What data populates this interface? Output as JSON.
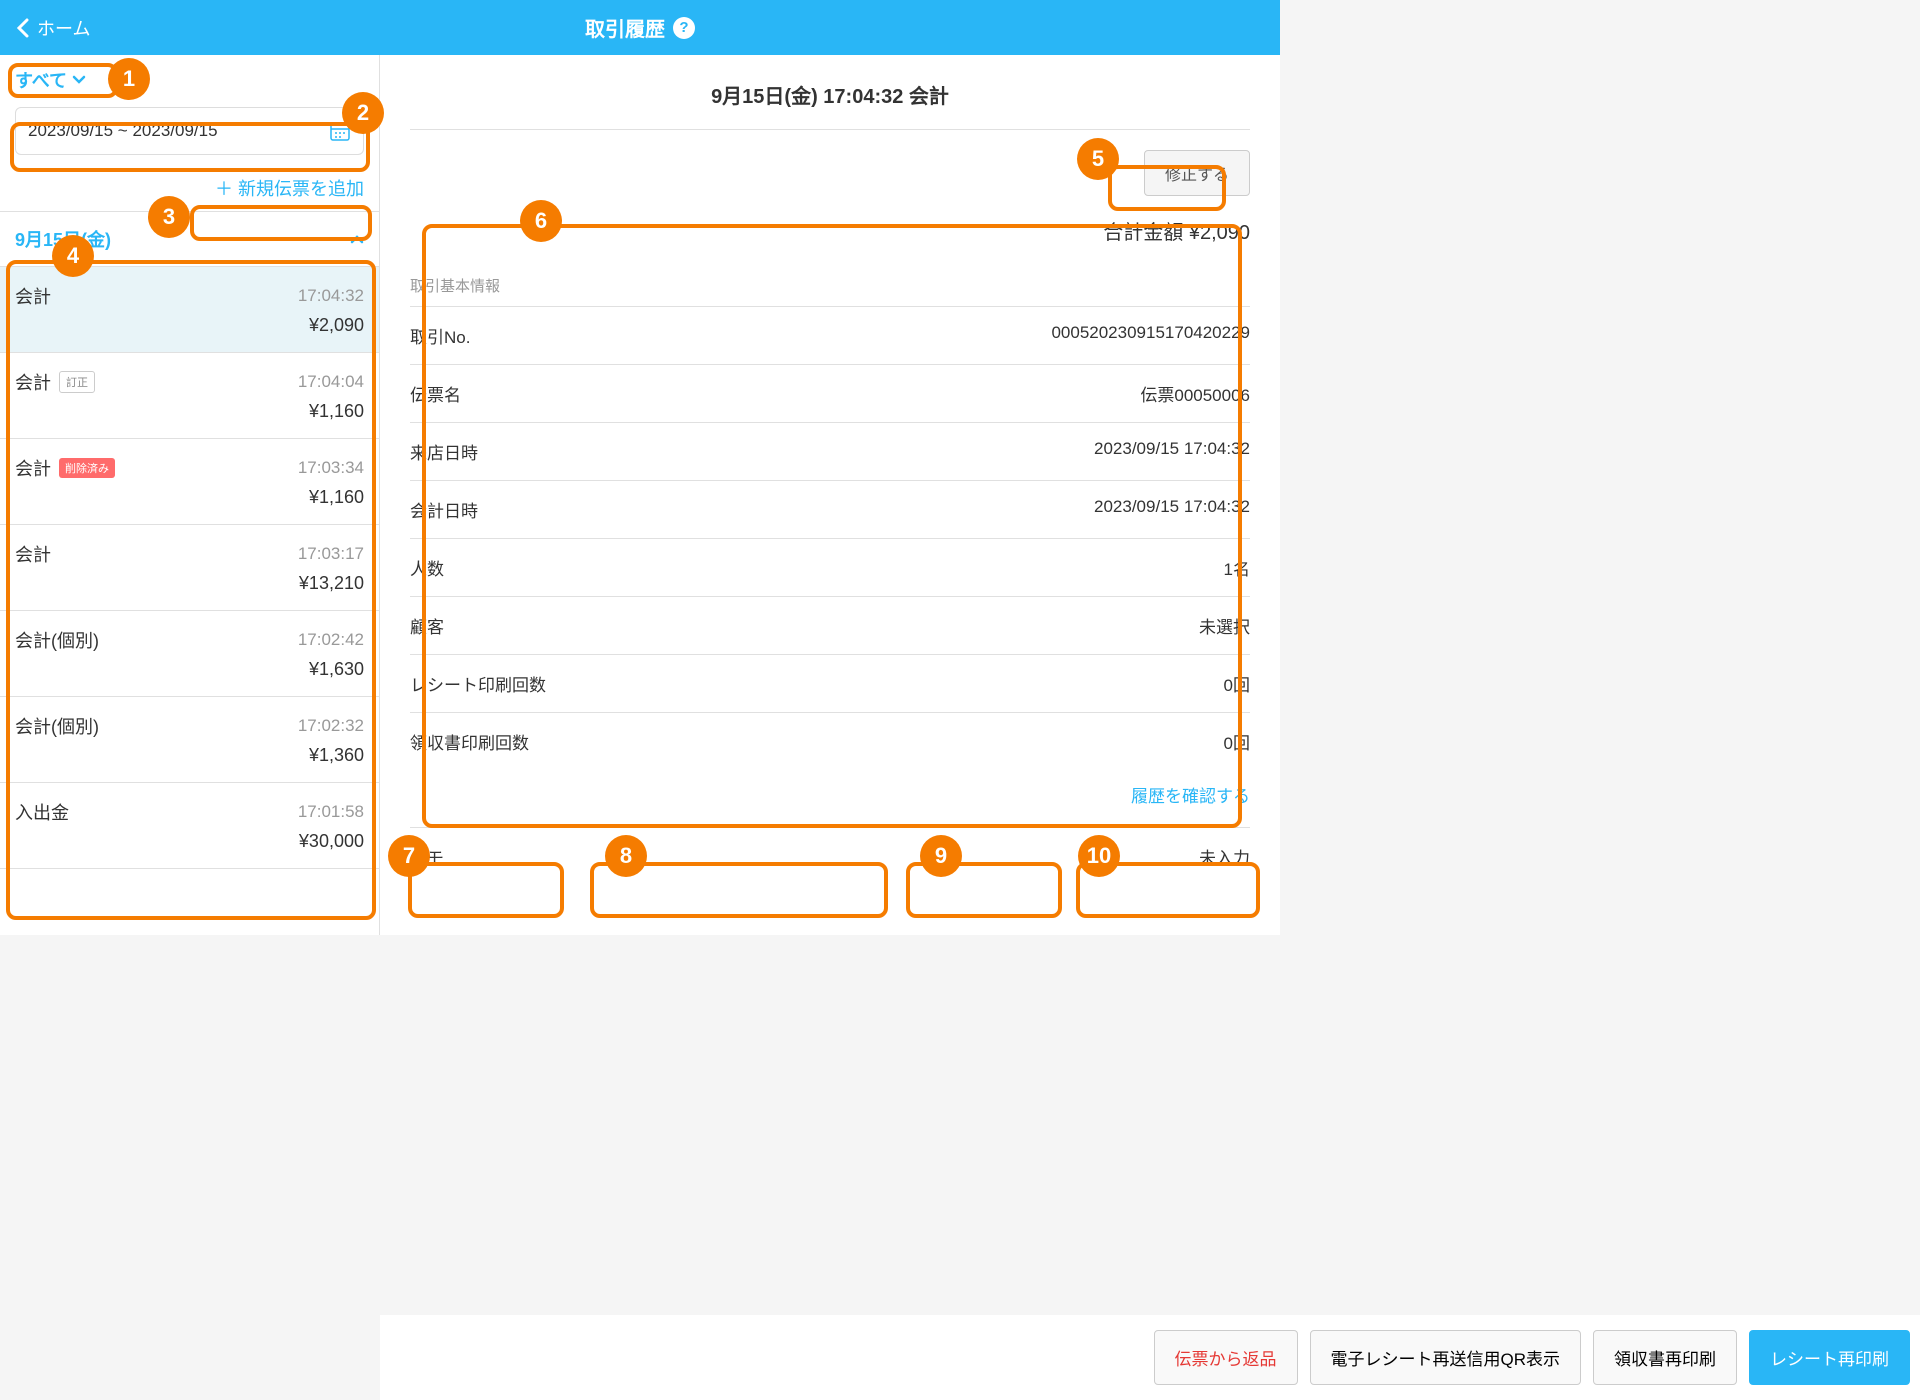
{
  "header": {
    "back_label": "ホーム",
    "title": "取引履歴"
  },
  "sidebar": {
    "filter_label": "すべて",
    "date_range": "2023/09/15 ~ 2023/09/15",
    "add_slip_label": "＋ 新規伝票を追加",
    "date_header": "9月15日(金)",
    "transactions": [
      {
        "label": "会計",
        "time": "17:04:32",
        "amount": "¥2,090",
        "badge": null,
        "selected": true
      },
      {
        "label": "会計",
        "time": "17:04:04",
        "amount": "¥1,160",
        "badge": "訂正",
        "selected": false
      },
      {
        "label": "会計",
        "time": "17:03:34",
        "amount": "¥1,160",
        "badge": "削除済み",
        "badge_type": "deleted",
        "selected": false
      },
      {
        "label": "会計",
        "time": "17:03:17",
        "amount": "¥13,210",
        "badge": null,
        "selected": false
      },
      {
        "label": "会計(個別)",
        "time": "17:02:42",
        "amount": "¥1,630",
        "badge": null,
        "selected": false
      },
      {
        "label": "会計(個別)",
        "time": "17:02:32",
        "amount": "¥1,360",
        "badge": null,
        "selected": false
      },
      {
        "label": "入出金",
        "time": "17:01:58",
        "amount": "¥30,000",
        "badge": null,
        "selected": false
      }
    ]
  },
  "main": {
    "title": "9月15日(金) 17:04:32 会計",
    "edit_button": "修正する",
    "total_label": "合計金額 ¥2,090",
    "section_label": "取引基本情報",
    "info": [
      {
        "label": "取引No.",
        "value": "000520230915170420229"
      },
      {
        "label": "伝票名",
        "value": "伝票00050006"
      },
      {
        "label": "来店日時",
        "value": "2023/09/15 17:04:32"
      },
      {
        "label": "会計日時",
        "value": "2023/09/15 17:04:32"
      },
      {
        "label": "人数",
        "value": "1名"
      },
      {
        "label": "顧客",
        "value": "未選択"
      },
      {
        "label": "レシート印刷回数",
        "value": "0回"
      },
      {
        "label": "領収書印刷回数",
        "value": "0回"
      }
    ],
    "history_link": "履歴を確認する",
    "memo_label": "メモ",
    "memo_value": "未入力"
  },
  "footer": {
    "return_btn": "伝票から返品",
    "qr_btn": "電子レシート再送信用QR表示",
    "receipt_btn": "領収書再印刷",
    "reprint_btn": "レシート再印刷"
  },
  "annotations": {
    "n1": "1",
    "n2": "2",
    "n3": "3",
    "n4": "4",
    "n5": "5",
    "n6": "6",
    "n7": "7",
    "n8": "8",
    "n9": "9",
    "n10": "10"
  }
}
